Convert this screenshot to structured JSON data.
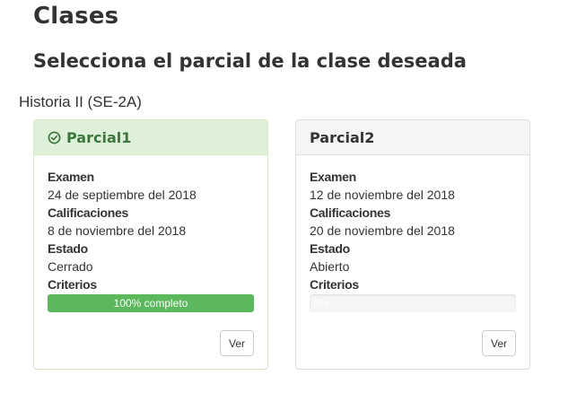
{
  "page": {
    "title": "Clases",
    "subtitle": "Selecciona el parcial de la clase deseada",
    "class_name": "Historia II (SE-2A)"
  },
  "colors": {
    "success_header_bg": "#dff0d8",
    "success_text": "#3c763d",
    "progress_green": "#5cb85c",
    "default_header_bg": "#f5f5f5"
  },
  "parciales": [
    {
      "name": "Parcial1",
      "status_icon": "check-circle-icon",
      "exam_label": "Examen",
      "exam_date": "24 de septiembre del 2018",
      "grades_label": "Calificaciones",
      "grades_date": "8 de noviembre del 2018",
      "state_label": "Estado",
      "state": "Cerrado",
      "criteria_label": "Criterios",
      "progress_percent": 100,
      "progress_text": "100% completo",
      "button_label": "Ver"
    },
    {
      "name": "Parcial2",
      "exam_label": "Examen",
      "exam_date": "12 de noviembre del 2018",
      "grades_label": "Calificaciones",
      "grades_date": "20 de noviembre del 2018",
      "state_label": "Estado",
      "state": "Abierto",
      "criteria_label": "Criterios",
      "progress_percent": 0,
      "progress_text": "0%",
      "button_label": "Ver"
    }
  ]
}
